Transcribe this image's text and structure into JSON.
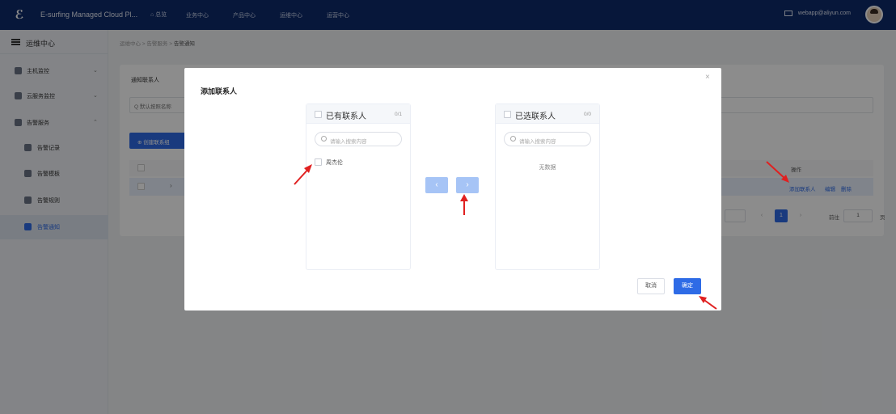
{
  "topbar": {
    "app_title": "E-surfing Managed Cloud Pl...",
    "home_label": "⌂ 总览",
    "nav": [
      "业务中心",
      "产品中心",
      "运维中心",
      "运营中心"
    ],
    "user_email": "webapp@aliyun.com"
  },
  "sidebar": {
    "title": "运维中心",
    "items": [
      {
        "label": "主机监控",
        "chevron": "⌄"
      },
      {
        "label": "云服务监控",
        "chevron": "⌄"
      },
      {
        "label": "告警服务",
        "chevron": "⌃"
      },
      {
        "label": "告警记录"
      },
      {
        "label": "告警模板"
      },
      {
        "label": "告警规则"
      },
      {
        "label": "告警通知"
      }
    ]
  },
  "breadcrumb": {
    "parts": [
      "运维中心",
      "告警服务"
    ],
    "sep": " > ",
    "current": "告警通知"
  },
  "background": {
    "tab_label": "通知联系人",
    "search_placeholder": "Q 默认按照名称",
    "create_button": "⊕ 创建联系组",
    "op_header": "操作",
    "row_expand": "›",
    "row_actions": [
      "添加联系人",
      "编辑",
      "删除"
    ],
    "pager": {
      "current": "1",
      "prev": "‹",
      "next": "›",
      "goto_label": "前往",
      "goto_value": "1",
      "suffix": "页"
    }
  },
  "modal": {
    "title": "添加联系人",
    "close": "×",
    "left_panel": {
      "title": "已有联系人",
      "count": "0/1",
      "search_placeholder": "请输入搜索内容",
      "items": [
        "周杰伦"
      ]
    },
    "right_panel": {
      "title": "已选联系人",
      "count": "0/0",
      "search_placeholder": "请输入搜索内容",
      "empty_text": "无数据"
    },
    "move_left": "‹",
    "move_right": "›",
    "cancel": "取消",
    "confirm": "确定"
  },
  "colors": {
    "primary": "#2e6be6",
    "topbar": "#0e2a6b",
    "annotation": "#e02020"
  }
}
